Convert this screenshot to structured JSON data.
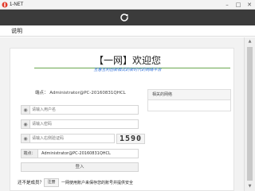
{
  "window": {
    "title": "1-NET",
    "controls": {
      "minimize": "–",
      "maximize": "□",
      "close": "✕"
    }
  },
  "toolbar": {
    "refresh_icon": "refresh-icon"
  },
  "menu": {
    "help_label": "说明"
  },
  "hero": {
    "title": "【一网】欢迎您",
    "subtitle": "互惠互利创新模式的新时代的网络平台"
  },
  "terminal_info": {
    "text": "端点： Administrator@PC-20160831QHCL"
  },
  "form": {
    "username_placeholder": "请输入用户名",
    "password_placeholder": "请输入密码",
    "captcha_placeholder": "请输入右侧验证码",
    "captcha_code": "1590",
    "terminal_label": "端点：",
    "terminal_value": "Administrator@PC-20160831QHCL",
    "login_label": "登入"
  },
  "panel": {
    "title": "相关的网络"
  },
  "register": {
    "prompt": "还不是成员？",
    "button_label": "注册",
    "note": "一网使用账户来保存您的账号并提供安全"
  },
  "colors": {
    "toolbar_bg": "#3b3b3b",
    "accent_blue": "#2a6bd8",
    "accent_green": "#6aa84f"
  }
}
